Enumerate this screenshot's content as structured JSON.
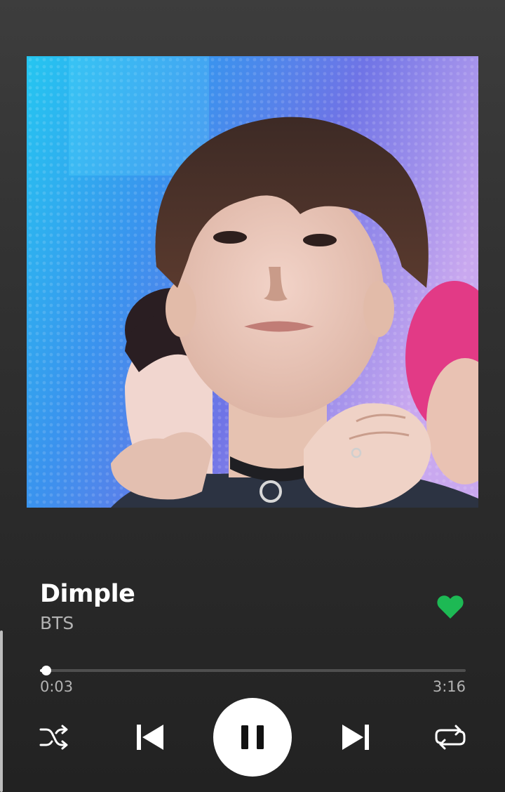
{
  "track": {
    "title": "Dimple",
    "artist": "BTS",
    "liked": true
  },
  "album_art": {
    "icon": "album-cover-image"
  },
  "playback": {
    "elapsed": "0:03",
    "total": "3:16",
    "progress_fraction": 0.015,
    "state": "playing"
  },
  "controls": {
    "shuffle_icon": "shuffle-icon",
    "previous_icon": "skip-previous-icon",
    "pause_icon": "pause-icon",
    "next_icon": "skip-next-icon",
    "repeat_icon": "repeat-icon"
  },
  "colors": {
    "accent": "#1db954",
    "background": "#2b2b2b",
    "secondary_text": "#b3b3b3",
    "primary_text": "#ffffff"
  }
}
